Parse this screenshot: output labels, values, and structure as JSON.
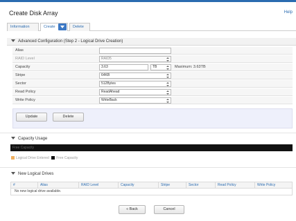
{
  "header": {
    "title": "Create Disk Array",
    "help_label": "Help"
  },
  "tabs": [
    {
      "label": "Information"
    },
    {
      "label": "Create"
    },
    {
      "label": "Delete"
    }
  ],
  "advanced": {
    "section_title": "Advanced Configuration (Step 2 - Logical Drive Creation)",
    "fields": {
      "alias": {
        "label": "Alias",
        "value": ""
      },
      "raid_level": {
        "label": "RAID Level",
        "value": "RAID5"
      },
      "capacity": {
        "label": "Capacity",
        "value": "3.63",
        "unit": "TB",
        "maximum": "Maximum: 3.63TB"
      },
      "stripe": {
        "label": "Stripe",
        "value": "64KB"
      },
      "sector": {
        "label": "Sector",
        "value": "512Bytes"
      },
      "read_policy": {
        "label": "Read Policy",
        "value": "ReadAhead"
      },
      "write_policy": {
        "label": "Write Policy",
        "value": "WriteBack"
      }
    },
    "buttons": {
      "update": "Update",
      "delete": "Delete"
    }
  },
  "capacity_usage": {
    "section_title": "Capacity Usage",
    "bar_label": "Free Capacity",
    "legend": {
      "used": "Logical Drive Entered",
      "free": "Free Capacity"
    },
    "colors": {
      "used": "#f0b060",
      "free": "#111111"
    }
  },
  "new_drives": {
    "section_title": "New Logical Drives",
    "columns": [
      "#",
      "Alias",
      "RAID Level",
      "Capacity",
      "Stripe",
      "Sector",
      "Read Policy",
      "Write Policy"
    ],
    "empty_message": "No new logical drive available."
  },
  "footer": {
    "back": "« Back",
    "cancel": "Cancel"
  },
  "colors": {
    "accent": "#2a6bb0",
    "top_bar": "#2a6bb0"
  }
}
